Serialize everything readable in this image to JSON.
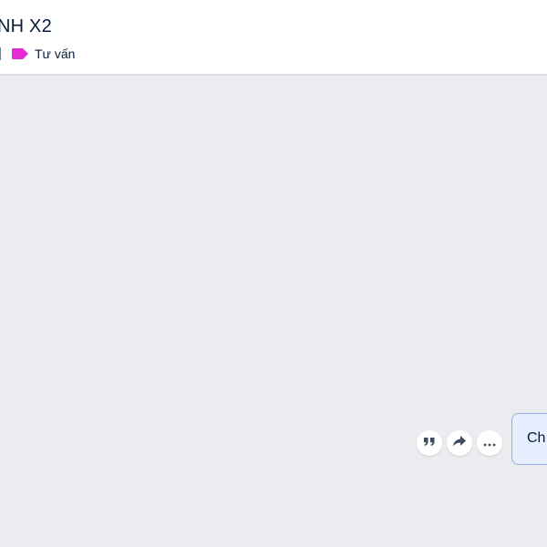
{
  "conversation": {
    "title": "NH X2",
    "tag": {
      "label": "Tư vấn",
      "color": "#e32bd6"
    }
  },
  "message_actions": [
    {
      "name": "quote",
      "icon": "quote-icon"
    },
    {
      "name": "forward",
      "icon": "forward-icon"
    },
    {
      "name": "more",
      "icon": "more-icon"
    }
  ],
  "message": {
    "text": "Ch",
    "bubble_color": "#e5efff",
    "border_color": "#8fb0dd"
  },
  "colors": {
    "chat_background": "#ebecf0",
    "header_background": "#ffffff",
    "text_primary": "#081c36"
  }
}
